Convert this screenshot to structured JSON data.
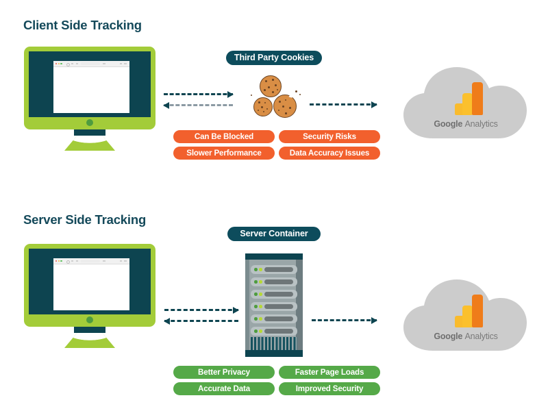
{
  "page": {
    "background": "#ffffff",
    "colors": {
      "heading": "#14495a",
      "label_pill": "#0d4c5c",
      "negative_tag": "#f2602d",
      "positive_tag": "#55a948",
      "monitor_frame": "#a3cc39",
      "monitor_screen": "#0d4450",
      "cloud": "#cccccc",
      "arrow_primary": "#0d4450",
      "arrow_secondary": "#8b9aa3",
      "cookie_fill": "#d98e45",
      "cookie_outline": "#6b4423"
    }
  },
  "sections": [
    {
      "id": "client",
      "title": "Client Side Tracking",
      "center_label": "Third Party Cookies",
      "center_icon": "cookies-icon",
      "left_node": "browser-monitor-icon",
      "right_node": "google-analytics-cloud-icon",
      "arrows": [
        {
          "name": "monitor-to-cookies-request-arrow",
          "direction": "right",
          "style": "solid-dark"
        },
        {
          "name": "cookies-to-monitor-response-arrow",
          "direction": "left",
          "style": "light"
        },
        {
          "name": "cookies-to-analytics-arrow",
          "direction": "right",
          "style": "solid-dark"
        }
      ],
      "tags": [
        {
          "label": "Can Be Blocked",
          "tone": "negative"
        },
        {
          "label": "Security Risks",
          "tone": "negative"
        },
        {
          "label": "Slower Performance",
          "tone": "negative"
        },
        {
          "label": "Data Accuracy Issues",
          "tone": "negative"
        }
      ]
    },
    {
      "id": "server",
      "title": "Server Side Tracking",
      "center_label": "Server Container",
      "center_icon": "server-rack-icon",
      "left_node": "browser-monitor-icon",
      "right_node": "google-analytics-cloud-icon",
      "arrows": [
        {
          "name": "monitor-to-server-request-arrow",
          "direction": "right",
          "style": "solid-dark"
        },
        {
          "name": "server-to-monitor-response-arrow",
          "direction": "left",
          "style": "solid-dark"
        },
        {
          "name": "server-to-analytics-arrow",
          "direction": "right",
          "style": "solid-dark"
        }
      ],
      "tags": [
        {
          "label": "Better Privacy",
          "tone": "positive"
        },
        {
          "label": "Faster Page Loads",
          "tone": "positive"
        },
        {
          "label": "Accurate Data",
          "tone": "positive"
        },
        {
          "label": "Improved Security",
          "tone": "positive"
        }
      ]
    }
  ],
  "analytics_cloud": {
    "brand_first": "Google",
    "brand_second": "Analytics",
    "logo_bars": [
      {
        "name": "short-bar",
        "color": "#f9bb2d"
      },
      {
        "name": "medium-bar",
        "color": "#fbc02d"
      },
      {
        "name": "tall-bar",
        "color": "#ef7c1a"
      }
    ]
  },
  "server_rack": {
    "slot_count": 6,
    "vent_label": "ventilation-grille",
    "led_colors": [
      "#4e9c3f",
      "#b7d935"
    ]
  }
}
